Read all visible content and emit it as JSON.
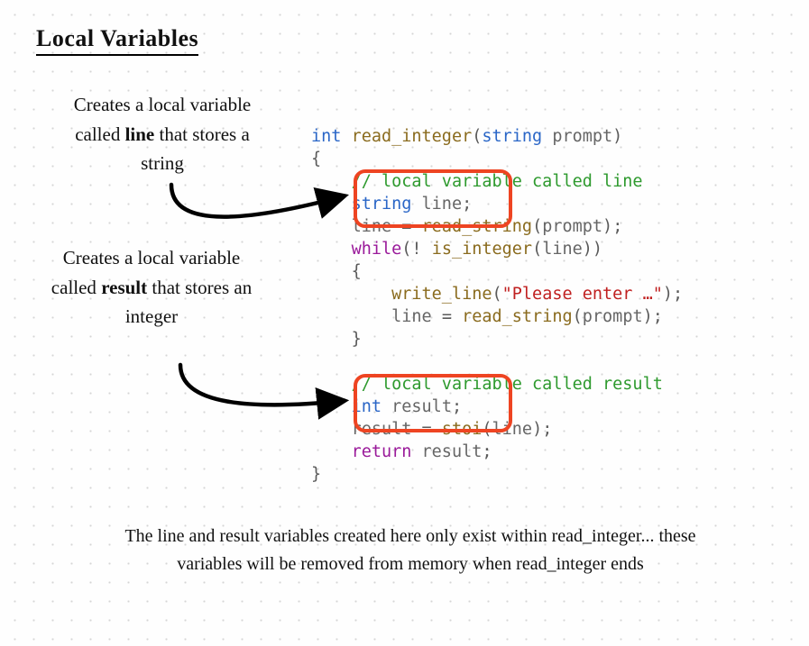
{
  "title": "Local Variables",
  "note1": {
    "prefix": "Creates a local variable called ",
    "bold": "line",
    "suffix": " that stores a string"
  },
  "note2": {
    "prefix": "Creates a local variable called ",
    "bold": "result",
    "suffix": " that stores an integer"
  },
  "note3": "The line and result variables created here only exist within read_integer... these variables will be removed from memory when read_integer ends",
  "code": {
    "t_int": "int",
    "fn_read_integer": "read_integer",
    "t_string": "string",
    "p_prompt": "prompt",
    "brace_open": "{",
    "brace_close": "}",
    "c1": "// local variable called line",
    "decl_line_type": "string",
    "decl_line_id": "line",
    "assign_line_lhs": "line",
    "eq": "=",
    "fn_read_string": "read_string",
    "kw_while": "while",
    "bang": "!",
    "fn_is_integer": "is_integer",
    "fn_write_line": "write_line",
    "str_please": "\"Please enter …\"",
    "c2": "// local variable called result",
    "decl_result_type": "int",
    "decl_result_id": "result",
    "assign_result_lhs": "result",
    "fn_stoi": "stoi",
    "kw_return": "return",
    "ret_id": "result",
    "semi": ";",
    "lpar": "(",
    "rpar": ")"
  }
}
